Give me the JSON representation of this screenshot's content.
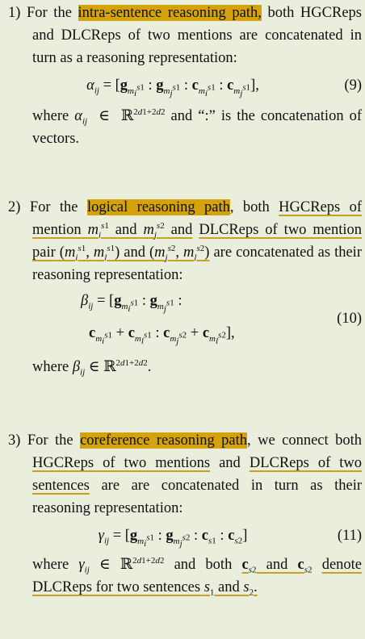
{
  "item1": {
    "number": "1)",
    "pre": "For the",
    "highlight": "intra-sentence reasoning path,",
    "post": "both HGCReps and DLCReps of two mentions are concatenated in turn as a reasoning representation:",
    "eq_number": "(9)",
    "where_tail": "and “:” is the concatenation of vectors."
  },
  "item2": {
    "number": "2)",
    "pre": "For the",
    "highlight": "logical reasoning path",
    "mid": ", both",
    "u1": "HGCReps of mention",
    "u2": "DLCReps of two mention pair",
    "post": "are concatenated as their reasoning representation:",
    "eq_number": "(10)"
  },
  "item3": {
    "number": "3)",
    "pre": "For the",
    "highlight": "coreference reasoning path",
    "mid": ", we connect both",
    "u1": "HGCReps of two mentions",
    "and_word": "and",
    "u2": "DLCReps of two sentences",
    "post": "are are concatenated in turn as their reasoning representation:",
    "eq_number": "(11)",
    "where_mid": "and both",
    "u3": "denote DLCReps for two sentences"
  }
}
